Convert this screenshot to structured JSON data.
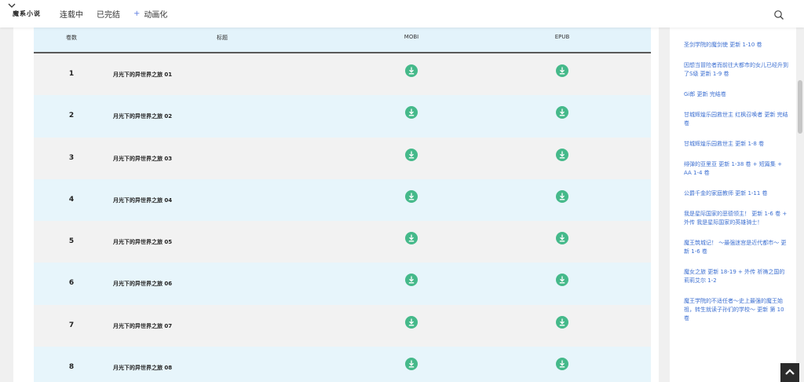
{
  "header": {
    "logo": "魔系小说",
    "nav": [
      {
        "label": "连载中",
        "prefix": ""
      },
      {
        "label": "已完结",
        "prefix": ""
      },
      {
        "label": "动画化",
        "prefix": "+"
      }
    ],
    "icons": {
      "search": "search-icon",
      "dropdown": "chevron-down-icon"
    }
  },
  "table": {
    "headers": {
      "volume": "卷数",
      "title": "标题",
      "mobi": "MOBI",
      "epub": "EPUB"
    },
    "rows": [
      {
        "num": "1",
        "title": "月光下的异世界之旅 01"
      },
      {
        "num": "2",
        "title": "月光下的异世界之旅 02"
      },
      {
        "num": "3",
        "title": "月光下的异世界之旅 03"
      },
      {
        "num": "4",
        "title": "月光下的异世界之旅 04"
      },
      {
        "num": "5",
        "title": "月光下的异世界之旅 05"
      },
      {
        "num": "6",
        "title": "月光下的异世界之旅 06"
      },
      {
        "num": "7",
        "title": "月光下的异世界之旅 07"
      },
      {
        "num": "8",
        "title": "月光下的异世界之旅 08"
      }
    ]
  },
  "sidebar": {
    "links": [
      "圣剑学院的魔剑使 更新 1-10 卷",
      "因想当冒险者而前往大都市的女儿已经升到了S级 更新 1-9 卷",
      "Gi郎 更新 完结卷",
      "甘城辉煌乐园救世主 红枫召唤者 更新 完结卷",
      "甘城辉煌乐园救世主 更新 1-8 卷",
      "绯弹的亚里亚 更新 1-38 卷 + 短篇集 + AA 1-4 卷",
      "公爵千金的家庭教师 更新 1-11 卷",
      "我是星际国家的恶德领主！ 更新 1-6 卷 + 外传 我是星际国家的英雄骑士！",
      "魔王筑城记！ ～最强迷宫是近代都市～ 更新 1-6 卷",
      "魔女之旅 更新 18-19 + 外传 祈祷之国的莉莉艾尔 1-2",
      "魔王学院的不适任者～史上最强的魔王始祖，转生就读子孙们的学校～ 更新 第 10 卷"
    ]
  },
  "colors": {
    "accent_green": "#45b98a",
    "link_blue": "#3c6fd1",
    "header_blue": "#e3f3fb",
    "row_blue": "#e7f5fb",
    "row_gray": "#f2f2f2"
  },
  "icons": {
    "download": "download-icon",
    "back_to_top": "arrow-up-icon"
  }
}
